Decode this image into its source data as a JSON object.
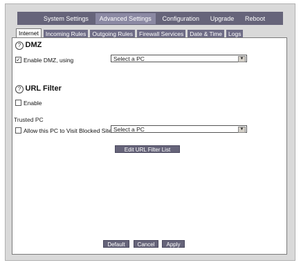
{
  "topnav": {
    "items": [
      "System Settings",
      "Advanced Settings",
      "Configuration",
      "Upgrade",
      "Reboot"
    ]
  },
  "tabs": [
    "Internet",
    "Incoming Rules",
    "Outgoing Rules",
    "Firewall Services",
    "Date & Time",
    "Logs"
  ],
  "dmz": {
    "help": "?",
    "title": "DMZ",
    "checkbox_checked": true,
    "checkbox_mark": "✓",
    "checkbox_label": "Enable DMZ, using",
    "select_value": "Select a PC"
  },
  "url_filter": {
    "help": "?",
    "title": "URL Filter",
    "checkbox_checked": false,
    "checkbox_label": "Enable"
  },
  "trusted_pc": {
    "heading": "Trusted PC",
    "checkbox_checked": false,
    "checkbox_label": "Allow this PC to Visit Blocked Sites",
    "select_value": "Select a PC"
  },
  "buttons": {
    "edit_url_filter": "Edit URL Filter List",
    "default": "Default",
    "cancel": "Cancel",
    "apply": "Apply"
  },
  "icons": {
    "select_arrow": "▼"
  }
}
